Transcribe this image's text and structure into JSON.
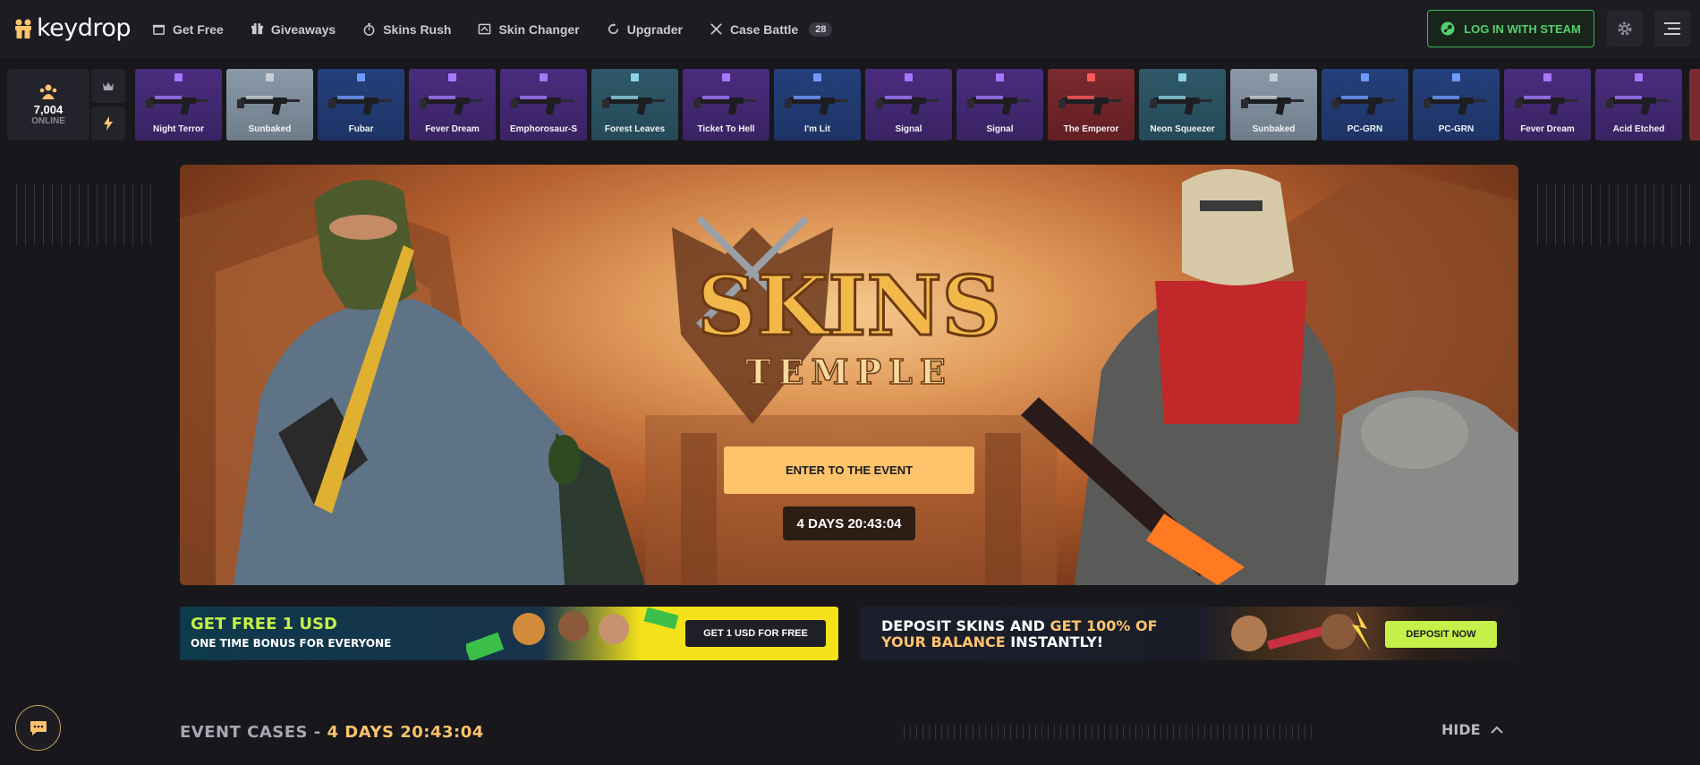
{
  "brand": {
    "name": "keydrop",
    "accent": "#ffc36b",
    "steam_green": "#3fb950"
  },
  "nav": {
    "items": [
      {
        "label": "Get Free",
        "icon": "gift-box-icon"
      },
      {
        "label": "Giveaways",
        "icon": "gift-icon"
      },
      {
        "label": "Skins Rush",
        "icon": "stopwatch-icon"
      },
      {
        "label": "Skin Changer",
        "icon": "swap-icon"
      },
      {
        "label": "Upgrader",
        "icon": "upgrade-circle-icon"
      },
      {
        "label": "Case Battle",
        "icon": "crossed-swords-icon",
        "badge": "28"
      }
    ],
    "login_label": "LOG IN WITH STEAM"
  },
  "online": {
    "count": "7,004",
    "label": "ONLINE"
  },
  "drops": [
    {
      "name": "Night Terror",
      "rarity": "purple"
    },
    {
      "name": "Sunbaked",
      "rarity": "grey"
    },
    {
      "name": "Fubar",
      "rarity": "blue"
    },
    {
      "name": "Fever Dream",
      "rarity": "purple"
    },
    {
      "name": "Emphorosaur-S",
      "rarity": "purple"
    },
    {
      "name": "Forest Leaves",
      "rarity": "teal"
    },
    {
      "name": "Ticket To Hell",
      "rarity": "purple"
    },
    {
      "name": "I'm Lit",
      "rarity": "blue"
    },
    {
      "name": "Signal",
      "rarity": "purple"
    },
    {
      "name": "Signal",
      "rarity": "purple"
    },
    {
      "name": "The Emperor",
      "rarity": "red"
    },
    {
      "name": "Neon Squeezer",
      "rarity": "teal"
    },
    {
      "name": "Sunbaked",
      "rarity": "grey"
    },
    {
      "name": "PC-GRN",
      "rarity": "blue"
    },
    {
      "name": "PC-GRN",
      "rarity": "blue"
    },
    {
      "name": "Fever Dream",
      "rarity": "purple"
    },
    {
      "name": "Acid Etched",
      "rarity": "purple"
    }
  ],
  "hero": {
    "title_line1": "SKINS",
    "title_line2": "TEMPLE",
    "enter_label": "ENTER TO THE EVENT",
    "countdown": "4 DAYS 20:43:04"
  },
  "promo_free": {
    "headline": "GET FREE 1 USD",
    "subline": "ONE TIME BONUS FOR EVERYONE",
    "button": "GET 1 USD FOR FREE"
  },
  "promo_deposit": {
    "line1_a": "DEPOSIT SKINS AND ",
    "line1_b": "GET 100% OF",
    "line2_a": "YOUR BALANCE",
    "line2_b": " INSTANTLY!",
    "button": "DEPOSIT NOW"
  },
  "event_cases": {
    "label": "EVENT CASES - ",
    "countdown": "4 DAYS 20:43:04",
    "hide_label": "HIDE"
  }
}
